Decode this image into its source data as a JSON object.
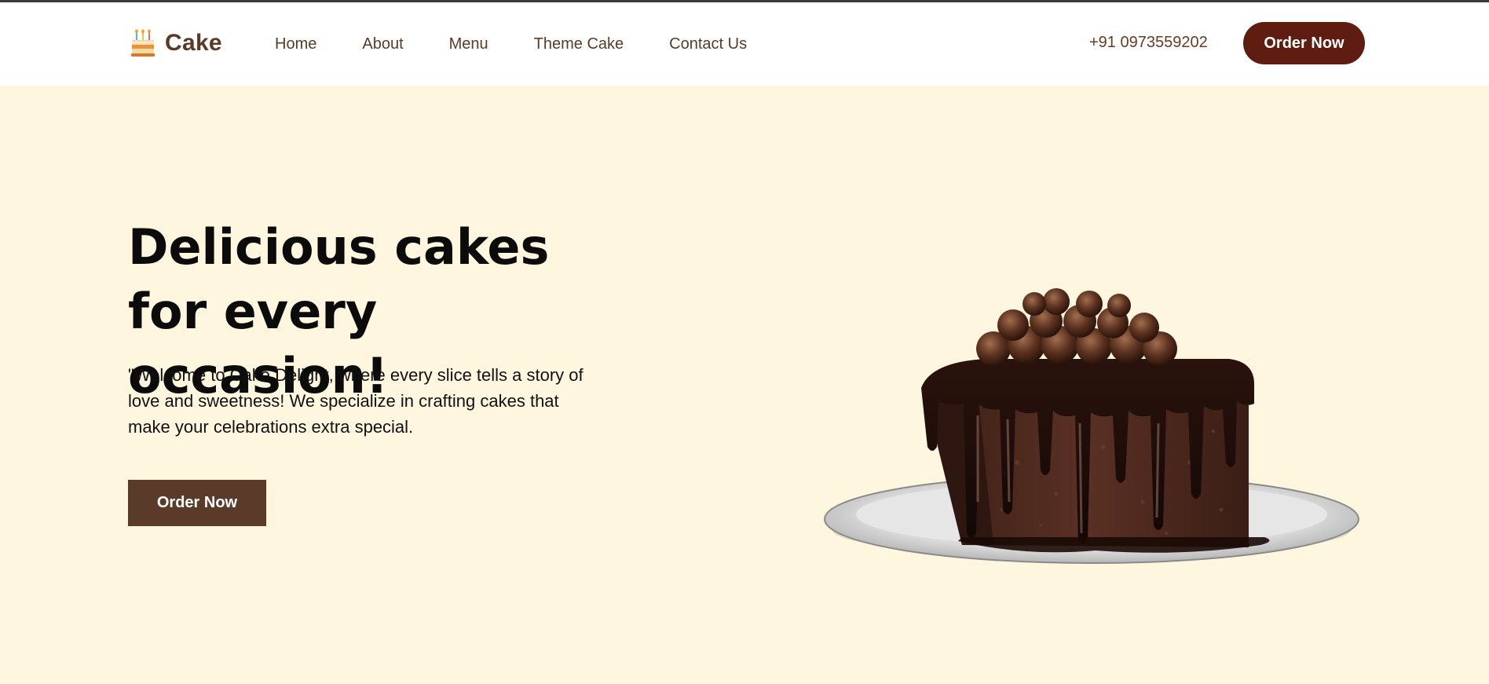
{
  "brand": {
    "name": "Cake"
  },
  "nav": {
    "items": [
      {
        "label": "Home"
      },
      {
        "label": "About"
      },
      {
        "label": "Menu"
      },
      {
        "label": "Theme Cake"
      },
      {
        "label": "Contact Us"
      }
    ]
  },
  "header": {
    "phone": "+91 0973559202",
    "order_label": "Order Now"
  },
  "hero": {
    "title": "Delicious cakes for every occasion!",
    "text": "\"Welcome to Cake Delight, where every slice tells a story of love and sweetness! We specialize in crafting cakes that make your celebrations extra special.",
    "order_label": "Order Now"
  },
  "colors": {
    "accent_dark_red": "#5e1d10",
    "brown": "#5a3a28",
    "hero_background": "#fef6de"
  },
  "icons": {
    "brand": "birthday-cake-icon"
  }
}
